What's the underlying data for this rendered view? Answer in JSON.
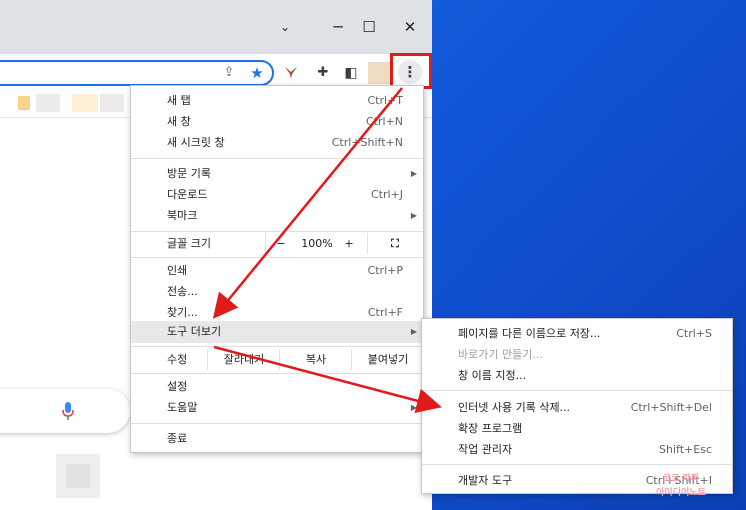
{
  "menu": {
    "items": [
      {
        "label": "새 탭",
        "shortcut": "Ctrl+T"
      },
      {
        "label": "새 창",
        "shortcut": "Ctrl+N"
      },
      {
        "label": "새 시크릿 창",
        "shortcut": "Ctrl+Shift+N"
      },
      {
        "label": "방문 기록",
        "shortcut": ""
      },
      {
        "label": "다운로드",
        "shortcut": "Ctrl+J"
      },
      {
        "label": "북마크",
        "shortcut": ""
      },
      {
        "label": "인쇄",
        "shortcut": "Ctrl+P"
      },
      {
        "label": "전송...",
        "shortcut": ""
      },
      {
        "label": "찾기...",
        "shortcut": "Ctrl+F"
      },
      {
        "label": "도구 더보기",
        "shortcut": ""
      },
      {
        "label": "설정",
        "shortcut": ""
      },
      {
        "label": "도움말",
        "shortcut": ""
      },
      {
        "label": "종료",
        "shortcut": ""
      }
    ],
    "zoom": {
      "label": "글꼴 크기",
      "minus": "−",
      "value": "100%",
      "plus": "+",
      "fullscreen": "⛶"
    },
    "edit": {
      "label": "수정",
      "cut": "잘라내기",
      "copy": "복사",
      "paste": "붙여넣기"
    }
  },
  "submenu": {
    "items": [
      {
        "label": "페이지를 다른 이름으로 저장...",
        "shortcut": "Ctrl+S"
      },
      {
        "label": "바로가기 만들기...",
        "shortcut": ""
      },
      {
        "label": "창 이름 지정...",
        "shortcut": ""
      },
      {
        "label": "인터넷 사용 기록 삭제...",
        "shortcut": "Ctrl+Shift+Del"
      },
      {
        "label": "확장 프로그램",
        "shortcut": ""
      },
      {
        "label": "작업 관리자",
        "shortcut": "Shift+Esc"
      },
      {
        "label": "개발자 도구",
        "shortcut": "Ctrl+Shift+I"
      }
    ]
  },
  "window": {
    "minimize": "─",
    "maximize": "☐",
    "close": "✕",
    "dropdown": "⌄"
  },
  "toolbar": {
    "menu_glyph": "⋮",
    "share": "⇪",
    "star": "★",
    "ext_puzzle": "✚",
    "sidebar": "◧"
  },
  "watermark": {
    "line1": "코코 파파",
    "line2": "아이디어노트"
  },
  "colors": {
    "accent": "#1a73e8",
    "highlight": "#e21a1a",
    "desktop": "#1256d8"
  }
}
